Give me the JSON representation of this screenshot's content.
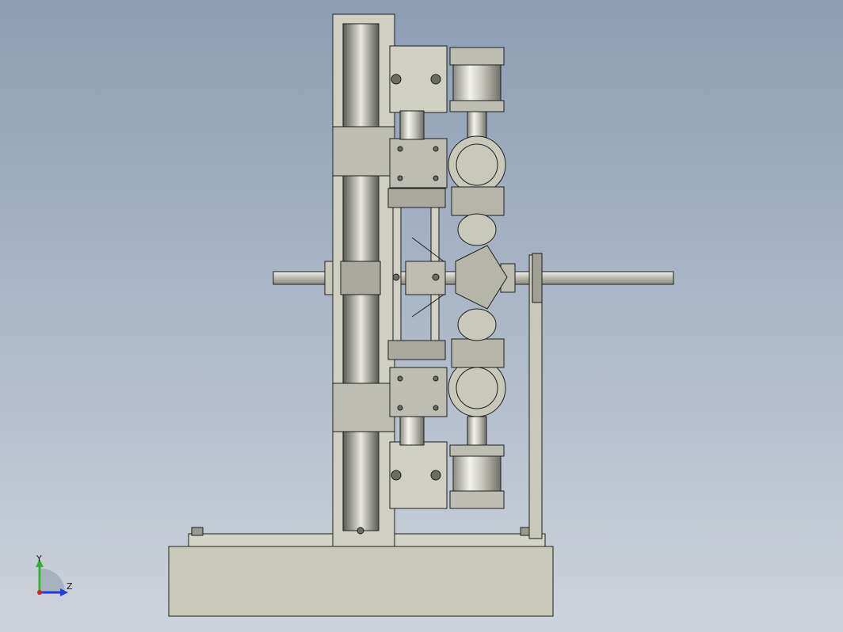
{
  "viewport": {
    "background_top": "#8d9db3",
    "background_bottom": "#cdd3db"
  },
  "triad": {
    "y_label": "Y",
    "z_label": "Z",
    "y_color": "#2db32d",
    "z_color": "#1f3fd6",
    "x_color": "#d62020"
  },
  "model": {
    "body_fill": "#c8c8bb",
    "metal_fill": "#d9d9d2",
    "edge_color": "#1e1e1e",
    "shadow_fill": "#7e7e76"
  }
}
